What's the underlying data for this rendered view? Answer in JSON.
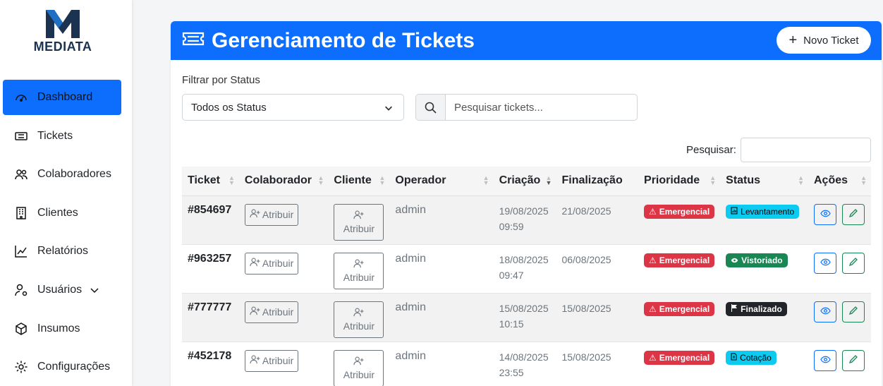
{
  "brand": {
    "name": "MEDIATA"
  },
  "sidebar": {
    "items": [
      {
        "label": "Dashboard",
        "icon": "speedometer-icon",
        "active": true
      },
      {
        "label": "Tickets",
        "icon": "ticket-icon"
      },
      {
        "label": "Colaboradores",
        "icon": "people-icon"
      },
      {
        "label": "Clientes",
        "icon": "building-icon"
      },
      {
        "label": "Relatórios",
        "icon": "chart-line-icon"
      },
      {
        "label": "Usuários",
        "icon": "user-gear-icon",
        "has_submenu": true
      },
      {
        "label": "Insumos",
        "icon": "box-icon"
      },
      {
        "label": "Configurações",
        "icon": "gear-icon"
      }
    ]
  },
  "header": {
    "title": "Gerenciamento de Tickets",
    "new_button": "Novo Ticket"
  },
  "filter": {
    "label": "Filtrar por Status",
    "selected": "Todos os Status",
    "search_placeholder": "Pesquisar tickets..."
  },
  "datatable": {
    "search_label": "Pesquisar:",
    "search_value": ""
  },
  "table": {
    "columns": [
      "Ticket",
      "Colaborador",
      "Cliente",
      "Operador",
      "Criação",
      "Finalização",
      "Prioridade",
      "Status",
      "Ações"
    ],
    "sorted_column": "Criação",
    "sort_direction": "desc",
    "assign_label": "Atribuir",
    "rows": [
      {
        "ticket": "#854697",
        "operator": "admin",
        "created_date": "19/08/2025",
        "created_time": "09:59",
        "finalized": "21/08/2025",
        "priority": "Emergencial",
        "status": "Levantamento",
        "status_color": "#0dcaf0"
      },
      {
        "ticket": "#963257",
        "operator": "admin",
        "created_date": "18/08/2025",
        "created_time": "09:47",
        "finalized": "06/08/2025",
        "priority": "Emergencial",
        "status": "Vistoriado",
        "status_color": "#198754"
      },
      {
        "ticket": "#777777",
        "operator": "admin",
        "created_date": "15/08/2025",
        "created_time": "10:15",
        "finalized": "15/08/2025",
        "priority": "Emergencial",
        "status": "Finalizado",
        "status_color": "#212529"
      },
      {
        "ticket": "#452178",
        "operator": "admin",
        "created_date": "14/08/2025",
        "created_time": "23:55",
        "finalized": "15/08/2025",
        "priority": "Emergencial",
        "status": "Cotação",
        "status_color": "#0dcaf0"
      }
    ]
  },
  "colors": {
    "primary": "#0d6efd",
    "danger": "#dc3545",
    "info": "#0dcaf0",
    "success": "#198754",
    "dark": "#212529"
  }
}
